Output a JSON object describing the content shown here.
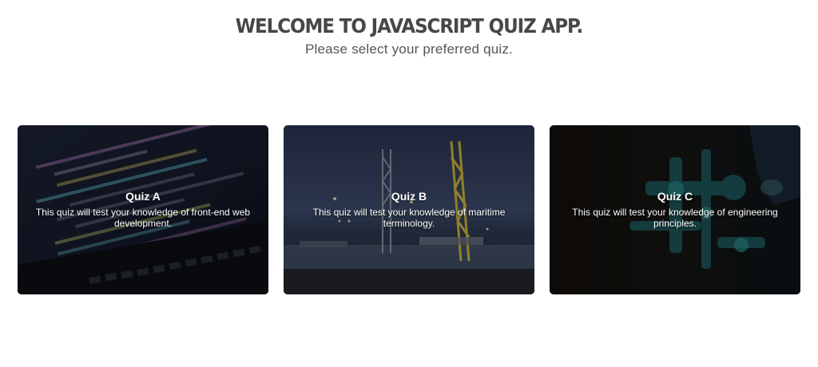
{
  "header": {
    "title": "WELCOME TO JAVASCRIPT QUIZ APP.",
    "subtitle": "Please select your preferred quiz."
  },
  "quizzes": [
    {
      "title": "Quiz A",
      "description": "This quiz will test your knowledge of front-end web development."
    },
    {
      "title": "Quiz B",
      "description": "This quiz will test your knowledge of maritime terminology."
    },
    {
      "title": "Quiz C",
      "description": "This quiz will test your knowledge of engineering principles."
    }
  ],
  "colors": {
    "title": "#474747",
    "subtitle": "#555555",
    "card_text": "#ffffff"
  }
}
